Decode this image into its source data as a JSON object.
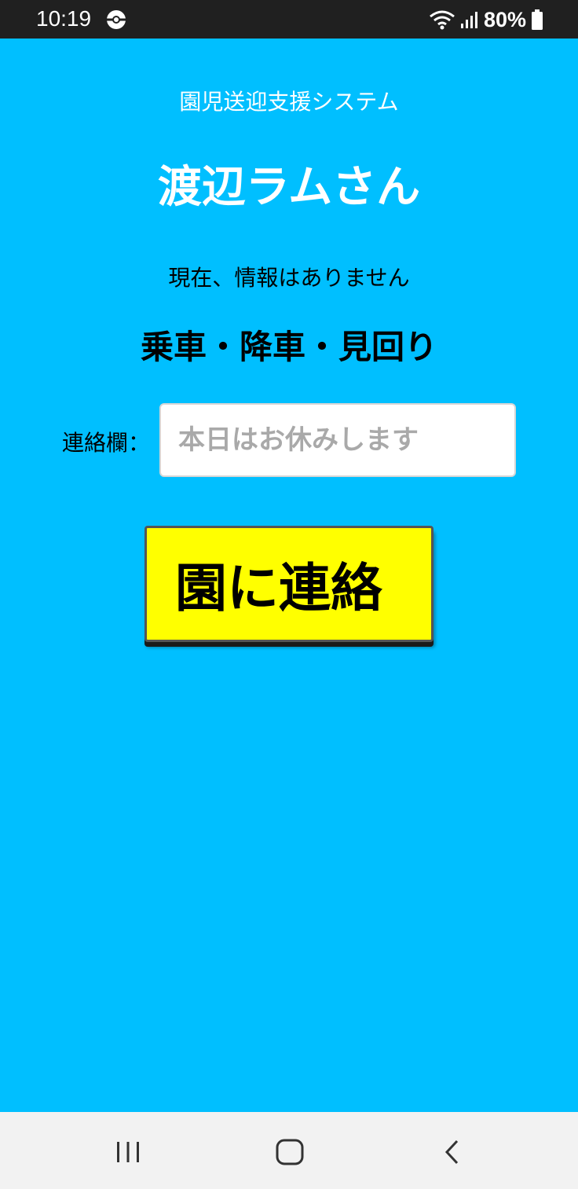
{
  "status_bar": {
    "time": "10:19",
    "battery": "80%",
    "icons": [
      "sync-icon",
      "wifi-icon",
      "signal-icon",
      "battery-icon"
    ]
  },
  "app": {
    "system_title": "園児送迎支援システム",
    "child_name": "渡辺ラムさん",
    "info_message": "現在、情報はありません",
    "status_heading": "乗車・降車・見回り"
  },
  "contact": {
    "label": "連絡欄：",
    "placeholder": "本日はお休みします",
    "value": ""
  },
  "send_button": {
    "label": "園に連絡"
  },
  "nav_bar": {
    "icons": [
      "recent-apps-icon",
      "home-icon",
      "back-icon"
    ]
  },
  "colors": {
    "background": "#00bfff",
    "button": "#ffff00",
    "status_bar": "#202020",
    "nav_bar": "#f2f2f2"
  }
}
